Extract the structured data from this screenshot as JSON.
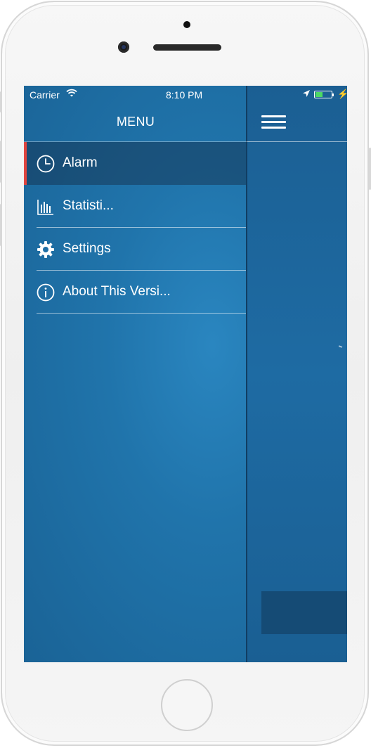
{
  "status_bar": {
    "carrier": "Carrier",
    "time": "8:10 PM",
    "bolt": "⚡"
  },
  "menu": {
    "title": "MENU",
    "items": [
      {
        "label": "Alarm",
        "icon": "clock-icon",
        "active": true
      },
      {
        "label": "Statisti...",
        "icon": "bar-chart-icon",
        "active": false
      },
      {
        "label": "Settings",
        "icon": "gear-icon",
        "active": false
      },
      {
        "label": "About This Versi...",
        "icon": "info-icon",
        "active": false
      }
    ]
  },
  "colors": {
    "background": "#1f6ea3",
    "active_marker": "#e0453f",
    "battery_fill": "#4cd964"
  },
  "battery": {
    "level": 0.45
  }
}
